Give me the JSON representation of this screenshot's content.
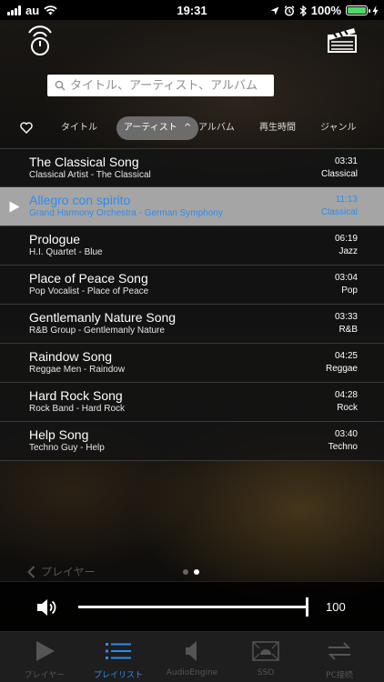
{
  "status_bar": {
    "carrier": "au",
    "time": "19:31",
    "battery_percent": "100%",
    "battery_level": 1.0
  },
  "header": {
    "left_icon": "power-remote-icon",
    "right_icon": "clapperboard-icon"
  },
  "search": {
    "placeholder": "タイトル、アーティスト、アルバム",
    "value": ""
  },
  "sort_tabs": {
    "favorite_icon": "heart-icon",
    "items": [
      {
        "label": "タイトル",
        "active": false
      },
      {
        "label": "アーティスト",
        "active": true,
        "arrow": "^"
      },
      {
        "label": "アルバム",
        "active": false
      },
      {
        "label": "再生時間",
        "active": false
      },
      {
        "label": "ジャンル",
        "active": false
      }
    ]
  },
  "songs": [
    {
      "title": "The Classical Song",
      "subtitle": "Classical Artist - The Classical",
      "duration": "03:31",
      "genre": "Classical",
      "selected": false
    },
    {
      "title": "Allegro con spirito",
      "subtitle": "Grand Harmony Orchestra - German Symphony",
      "duration": "11:13",
      "genre": "Classical",
      "selected": true
    },
    {
      "title": "Prologue",
      "subtitle": "H.I. Quartet - Blue",
      "duration": "06:19",
      "genre": "Jazz",
      "selected": false
    },
    {
      "title": "Place of Peace Song",
      "subtitle": "Pop Vocalist - Place of Peace",
      "duration": "03:04",
      "genre": "Pop",
      "selected": false
    },
    {
      "title": "Gentlemanly Nature Song",
      "subtitle": "R&B Group - Gentlemanly Nature",
      "duration": "03:33",
      "genre": "R&B",
      "selected": false
    },
    {
      "title": "Raindow Song",
      "subtitle": "Reggae Men - Raindow",
      "duration": "04:25",
      "genre": "Reggae",
      "selected": false
    },
    {
      "title": "Hard Rock Song",
      "subtitle": "Rock Band - Hard Rock",
      "duration": "04:28",
      "genre": "Rock",
      "selected": false
    },
    {
      "title": "Help Song",
      "subtitle": "Techno Guy - Help",
      "duration": "03:40",
      "genre": "Techno",
      "selected": false
    }
  ],
  "pager": {
    "back_label": "プレイヤー",
    "page_count": 2,
    "current_page": 2
  },
  "volume": {
    "value": "100",
    "level": 1.0
  },
  "tab_bar": [
    {
      "label": "プレイヤー",
      "icon": "play-icon",
      "active": false
    },
    {
      "label": "プレイリスト",
      "icon": "list-icon",
      "active": true
    },
    {
      "label": "AudioEngine",
      "icon": "speaker-icon",
      "active": false
    },
    {
      "label": "SSO",
      "icon": "sso-icon",
      "active": false
    },
    {
      "label": "PC接続",
      "icon": "transfer-arrows-icon",
      "active": false
    }
  ],
  "colors": {
    "accent": "#2f8cf0",
    "selected_row": "#a5a5a5",
    "battery": "#4cd964"
  }
}
